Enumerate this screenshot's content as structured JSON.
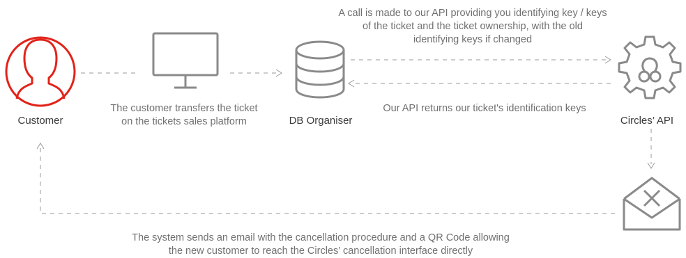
{
  "nodes": {
    "customer": {
      "label": "Customer",
      "icon": "user-icon",
      "color": "#e2231a"
    },
    "monitor": {
      "icon": "monitor-icon"
    },
    "db_organiser": {
      "label": "DB Organiser",
      "icon": "database-icon"
    },
    "circles_api": {
      "label": "Circles’ API",
      "icon": "gear-icon"
    },
    "email": {
      "icon": "envelope-icon"
    }
  },
  "annotations": {
    "transfer": [
      "The customer transfers the ticket",
      "on the tickets sales platform"
    ],
    "api_call": [
      "A call is made to our API providing you identifying key / keys",
      "of the ticket and the ticket ownership, with the old",
      "identifying keys if changed"
    ],
    "api_return": "Our API returns our ticket's identification keys",
    "email_sent": [
      "The system sends an email with the cancellation  procedure and a QR Code allowing",
      "the new customer to reach the Circles’ cancellation interface directly"
    ]
  },
  "colors": {
    "accent": "#e2231a",
    "icon_gray": "#8a8a8a",
    "line_gray": "#9a9a9a"
  }
}
